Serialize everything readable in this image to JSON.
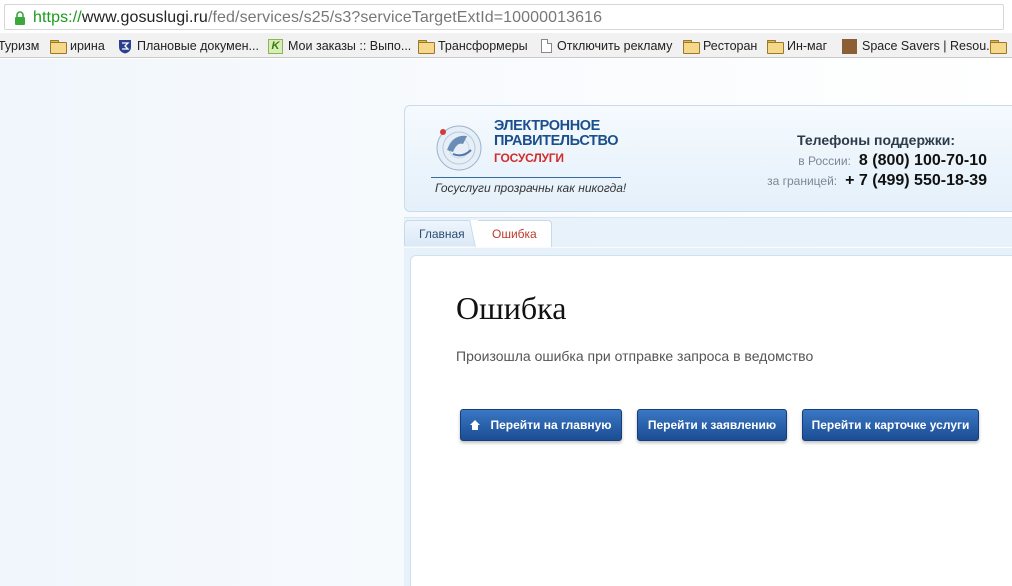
{
  "browser": {
    "url_scheme": "https://",
    "url_host": "www.gosuslugi.ru",
    "url_path": "/fed/services/s25/s3?serviceTargetExtId=10000013616"
  },
  "bookmarks": [
    {
      "label": "Туризм",
      "icon": "none"
    },
    {
      "label": "ирина",
      "icon": "folder-icon"
    },
    {
      "label": "Плановые докумен...",
      "icon": "shield-icon"
    },
    {
      "label": "Мои заказы :: Выпо...",
      "icon": "k-icon"
    },
    {
      "label": "Трансформеры",
      "icon": "folder-icon"
    },
    {
      "label": "Отключить рекламу",
      "icon": "page-icon"
    },
    {
      "label": "Ресторан",
      "icon": "folder-icon"
    },
    {
      "label": "Ин-маг",
      "icon": "folder-icon"
    },
    {
      "label": "Space Savers | Resou...",
      "icon": "site-icon"
    }
  ],
  "header": {
    "logo_line1": "ЭЛЕКТРОННОЕ",
    "logo_line2": "ПРАВИТЕЛЬСТВО",
    "logo_sub": "ГОСУСЛУГИ",
    "slogan": "Госуслуги прозрачны как никогда!",
    "support_title": "Телефоны поддержки:",
    "russia_label": "в России:",
    "russia_phone": "8 (800) 100-70-10",
    "abroad_label": "за границей:",
    "abroad_phone": "+ 7 (499) 550-18-39"
  },
  "breadcrumb": {
    "home": "Главная",
    "current": "Ошибка"
  },
  "main": {
    "title": "Ошибка",
    "message": "Произошла ошибка при отправке запроса в ведомство",
    "btn_home": "Перейти на главную",
    "btn_application": "Перейти к заявлению",
    "btn_service_card": "Перейти к карточке услуги"
  },
  "colors": {
    "button_blue": "#1b4d93",
    "error_red": "#c0392b",
    "brand_blue": "#1b4f8c"
  }
}
